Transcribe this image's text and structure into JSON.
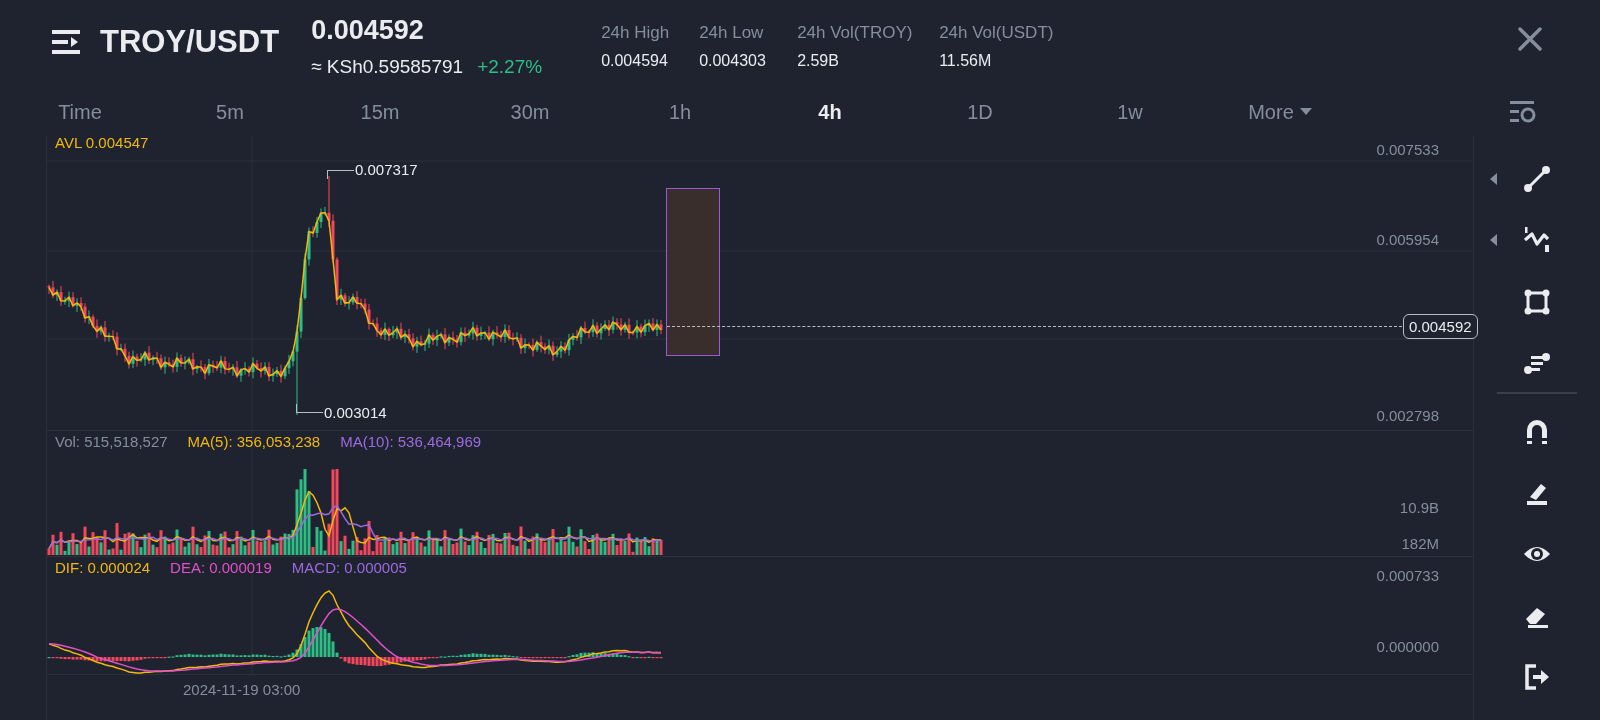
{
  "header": {
    "pair": "TROY/USDT",
    "price": "0.004592",
    "fiat_price": "≈ KSh0.59585791",
    "change": "+2.27%",
    "stats": [
      {
        "label": "24h High",
        "value": "0.004594"
      },
      {
        "label": "24h Low",
        "value": "0.004303"
      },
      {
        "label": "24h Vol(TROY)",
        "value": "2.59B"
      },
      {
        "label": "24h Vol(USDT)",
        "value": "11.56M"
      }
    ]
  },
  "intervals": [
    {
      "label": "Time",
      "selected": false
    },
    {
      "label": "5m",
      "selected": false
    },
    {
      "label": "15m",
      "selected": false
    },
    {
      "label": "30m",
      "selected": false
    },
    {
      "label": "1h",
      "selected": false
    },
    {
      "label": "4h",
      "selected": true
    },
    {
      "label": "1D",
      "selected": false
    },
    {
      "label": "1w",
      "selected": false
    },
    {
      "label": "More",
      "selected": false,
      "dropdown": true
    }
  ],
  "price_panel": {
    "legend": "AVL 0.004547",
    "axis_labels": [
      "0.007533",
      "0.005954",
      "0.002798"
    ],
    "high_label": "0.007317",
    "low_label": "0.003014",
    "last_price": "0.004592"
  },
  "volume_panel": {
    "legend": [
      {
        "text": "Vol: 515,518,527",
        "color": "#848e9c"
      },
      {
        "text": "MA(5): 356,053,238",
        "color": "#f0b90b"
      },
      {
        "text": "MA(10): 536,464,969",
        "color": "#9c6ade"
      }
    ],
    "axis_labels": [
      "10.9B",
      "182M"
    ]
  },
  "macd_panel": {
    "legend": [
      {
        "text": "DIF: 0.000024",
        "color": "#f0b90b"
      },
      {
        "text": "DEA: 0.000019",
        "color": "#e051c9"
      },
      {
        "text": "MACD: 0.000005",
        "color": "#9c6ade"
      }
    ],
    "axis_labels": [
      "0.000733",
      "0.000000"
    ]
  },
  "time_label": "2024-11-19 03:00",
  "drawing_tools": [
    {
      "kind": "line",
      "has_menu": true
    },
    {
      "kind": "wave",
      "has_menu": true
    },
    {
      "kind": "rectangle",
      "has_menu": false
    },
    {
      "kind": "levels",
      "has_menu": false
    }
  ],
  "chart_tools": [
    {
      "kind": "magnet"
    },
    {
      "kind": "pencil"
    },
    {
      "kind": "eye"
    },
    {
      "kind": "eraser"
    },
    {
      "kind": "exit"
    }
  ]
}
